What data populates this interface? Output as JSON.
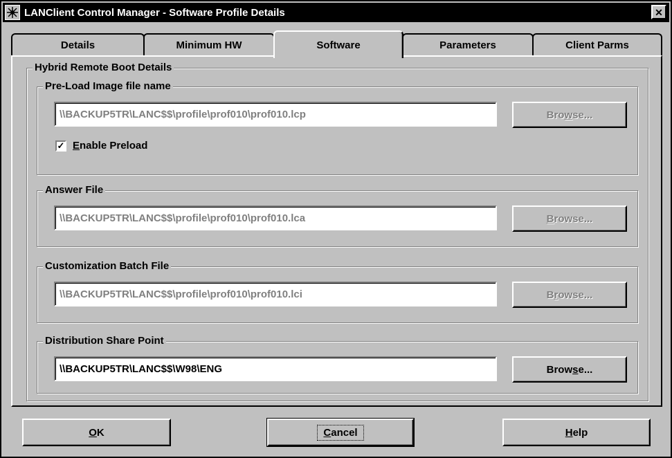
{
  "window": {
    "title": "LANClient Control Manager - Software Profile Details",
    "close_glyph": "✕"
  },
  "tabs": [
    {
      "label": "Details",
      "active": false
    },
    {
      "label": "Minimum HW",
      "active": false
    },
    {
      "label": "Software",
      "active": true
    },
    {
      "label": "Parameters",
      "active": false
    },
    {
      "label": "Client Parms",
      "active": false
    }
  ],
  "hybrid_group": {
    "title": "Hybrid Remote Boot Details"
  },
  "preload": {
    "title": "Pre-Load Image file name",
    "value": "\\\\BACKUP5TR\\LANC$$\\profile\\prof010\\prof010.lcp",
    "browse_pre": "Bro",
    "browse_key": "w",
    "browse_post": "se...",
    "checkbox_checked": true,
    "checkbox_mark": "✓",
    "checkbox_key": "E",
    "checkbox_rest": "nable Preload"
  },
  "answer": {
    "title": "Answer File",
    "value": "\\\\BACKUP5TR\\LANC$$\\profile\\prof010\\prof010.lca",
    "browse_pre": "",
    "browse_key": "B",
    "browse_post": "rowse..."
  },
  "batch": {
    "title": "Customization Batch File",
    "value": "\\\\BACKUP5TR\\LANC$$\\profile\\prof010\\prof010.lci",
    "browse_pre": "B",
    "browse_key": "r",
    "browse_post": "owse..."
  },
  "share": {
    "title": "Distribution Share Point",
    "value": "\\\\BACKUP5TR\\LANC$$\\W98\\ENG",
    "browse_pre": "Brow",
    "browse_key": "s",
    "browse_post": "e..."
  },
  "footer": {
    "ok_key": "O",
    "ok_rest": "K",
    "cancel_key": "C",
    "cancel_rest": "ancel",
    "help_key": "H",
    "help_rest": "elp"
  },
  "colors": {
    "face": "#c0c0c0",
    "shadow": "#808080",
    "highlight": "#ffffff",
    "disabled_text": "#808080"
  }
}
